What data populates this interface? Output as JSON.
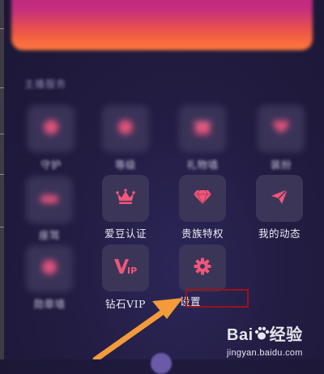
{
  "section": {
    "title": "主播服务"
  },
  "grid": {
    "row1": [
      "守护",
      "等级",
      "礼物墙",
      "装扮"
    ],
    "row2": [
      "座驾",
      "爱豆认证",
      "贵族特权",
      "我的动态"
    ],
    "row3": [
      "勋章墙",
      "钻石VIP",
      "设置"
    ]
  },
  "watermark": {
    "brand": "Bai",
    "brand2": "经验",
    "url": "jingyan.baidu.com"
  },
  "colors": {
    "background": "#221c42",
    "banner_top": "#b6208b",
    "banner_bottom": "#ff7a3d",
    "accent_pink": "#f0567a",
    "highlight_red": "#9b1218",
    "arrow_orange": "#f39a3b"
  },
  "icons": {
    "row1": [
      "shield-icon",
      "level-icon",
      "gift-box-icon",
      "heart-dress-icon"
    ],
    "row2": [
      "car-icon",
      "crown-icon",
      "diamond-icon",
      "paper-plane-icon"
    ],
    "row3": [
      "medal-icon",
      "vip-icon",
      "gear-icon"
    ]
  }
}
